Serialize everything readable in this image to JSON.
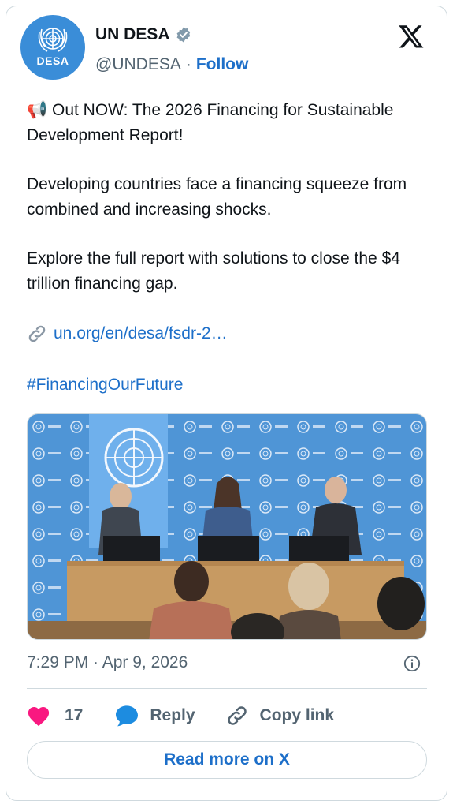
{
  "account": {
    "display_name": "UN DESA",
    "handle": "@UNDESA",
    "separator": "·",
    "follow_label": "Follow",
    "avatar_text": "DESA",
    "verified": true
  },
  "tweet": {
    "paragraphs": [
      "📢 Out NOW: The 2026 Financing for Sustainable Development Report!",
      "Developing countries face a financing squeeze from combined and increasing shocks.",
      "Explore the full report with solutions to close the $4 trillion financing gap."
    ],
    "link_text": "un.org/en/desa/fsdr-2…",
    "hashtag": "#FinancingOurFuture",
    "timestamp": "7:29 PM · Apr 9, 2026"
  },
  "actions": {
    "like_count": "17",
    "reply_label": "Reply",
    "copy_label": "Copy link",
    "read_more_label": "Read more on X"
  },
  "colors": {
    "accent": "#1d6fc9",
    "heart": "#f91880",
    "secondary_text": "#536471",
    "border": "#cfd9de",
    "avatar_bg": "#3a8dd8"
  },
  "icons": [
    "verified-badge-icon",
    "x-logo-icon",
    "link-icon",
    "info-icon",
    "heart-icon",
    "reply-bubble-icon",
    "copy-link-icon"
  ]
}
